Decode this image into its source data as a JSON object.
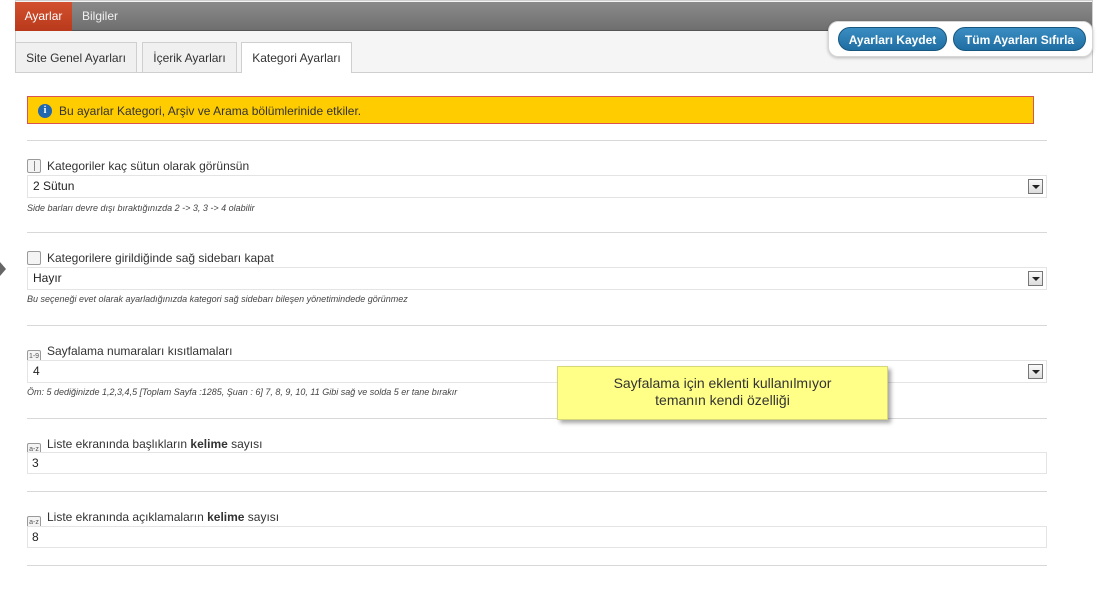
{
  "top_tabs": [
    "Ayarlar",
    "Bilgiler"
  ],
  "actions": {
    "save": "Ayarları Kaydet",
    "reset": "Tüm Ayarları Sıfırla"
  },
  "sub_tabs": [
    "Site Genel Ayarları",
    "İçerik Ayarları",
    "Kategori Ayarları"
  ],
  "notice": {
    "icon": "info-icon",
    "text": "Bu ayarlar Kategori, Arşiv ve Arama bölümlerinide etkiler."
  },
  "fields": {
    "columns": {
      "label": "Kategoriler kaç sütun olarak görünsün",
      "value": "2 Sütun",
      "hint": "Side barları devre dışı bıraktığınızda 2 -> 3, 3 -> 4 olabilir"
    },
    "sidebar": {
      "label": "Kategorilere girildiğinde sağ sidebarı kapat",
      "value": "Hayır",
      "hint": "Bu seçeneği evet olarak ayarladığınızda kategori sağ sidebarı bileşen yönetimindede görünmez"
    },
    "pagination": {
      "label": "Sayfalama numaraları kısıtlamaları",
      "value": "4",
      "hint": "Öm: 5 dediğinizde 1,2,3,4,5 [Toplam Sayfa :1285, Şuan : 6] 7, 8, 9, 10, 11 Gibi sağ ve solda 5 er tane bırakır",
      "icon_text": "1-9"
    },
    "title_words": {
      "label_before": "Liste ekranında başlıkların ",
      "label_bold": "kelime",
      "label_after": " sayısı",
      "value": "3",
      "icon_text": "a-z"
    },
    "desc_words": {
      "label_before": "Liste ekranında açıklamaların ",
      "label_bold": "kelime",
      "label_after": " sayısı",
      "value": "8",
      "icon_text": "a-z"
    }
  },
  "tooltip": {
    "line1": "Sayfalama için eklenti kullanılmıyor",
    "line2": "temanın kendi özelliği"
  }
}
